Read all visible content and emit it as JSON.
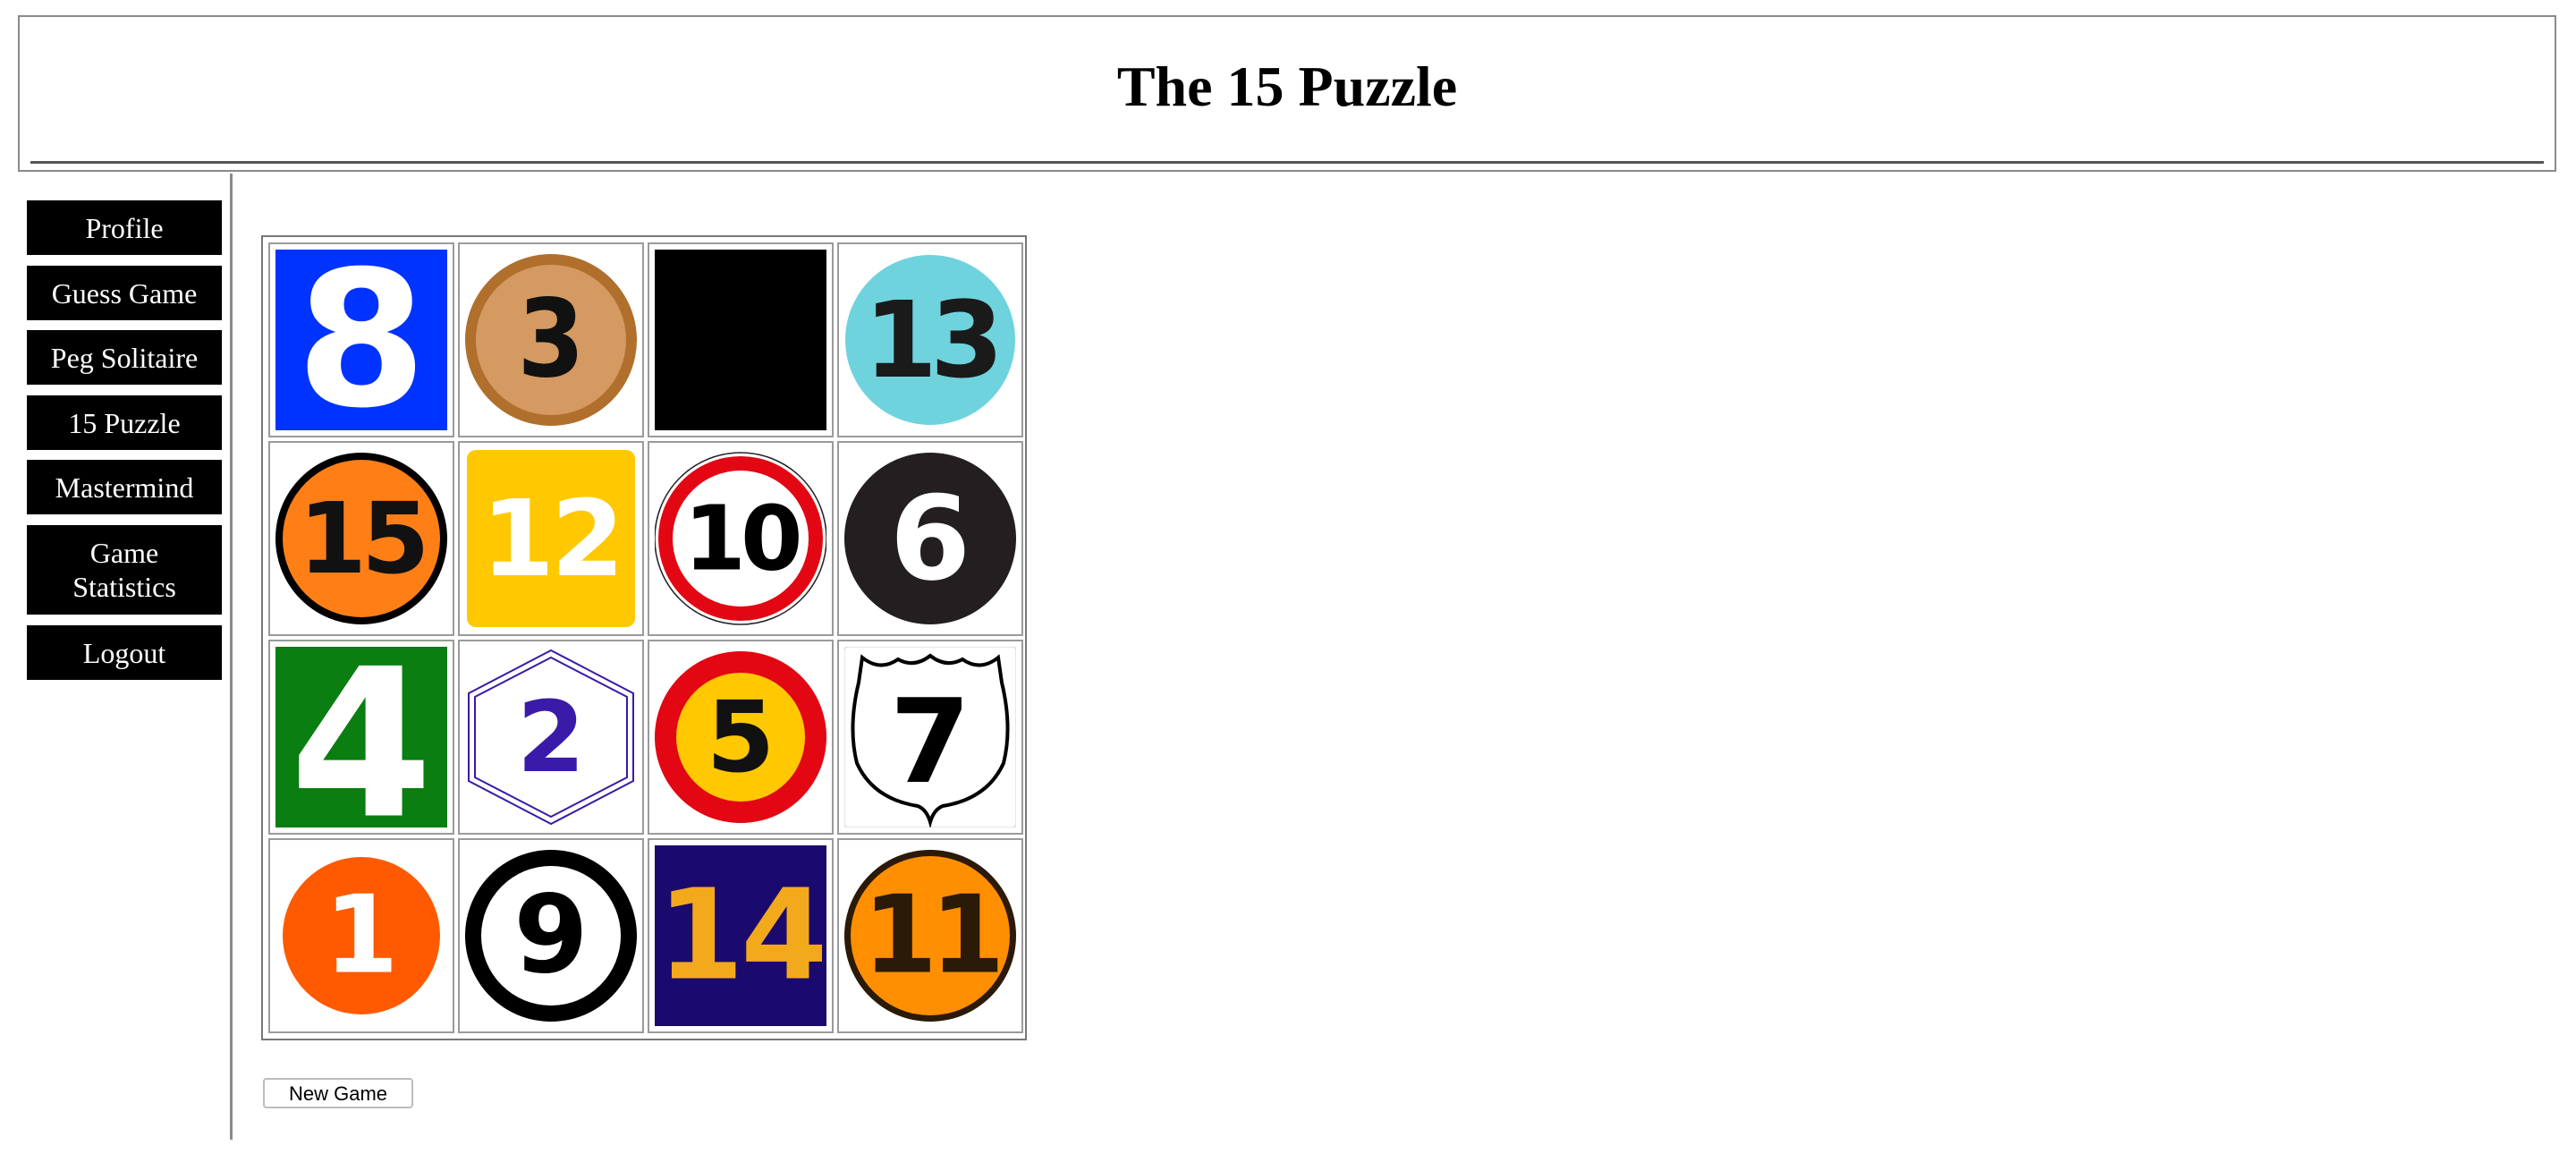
{
  "header": {
    "title": "The 15 Puzzle"
  },
  "sidebar": {
    "items": [
      {
        "label": "Profile"
      },
      {
        "label": "Guess Game"
      },
      {
        "label": "Peg Solitaire"
      },
      {
        "label": "15 Puzzle"
      },
      {
        "label": "Mastermind"
      },
      {
        "label": "Game Statistics"
      },
      {
        "label": "Logout"
      }
    ]
  },
  "puzzle": {
    "tiles": [
      {
        "value": "8",
        "style": "blue-square"
      },
      {
        "value": "3",
        "style": "bronze-circle"
      },
      {
        "value": "",
        "style": "empty-black"
      },
      {
        "value": "13",
        "style": "cyan-circle"
      },
      {
        "value": "15",
        "style": "orange-circle-black-ring"
      },
      {
        "value": "12",
        "style": "yellow-rounded-square"
      },
      {
        "value": "10",
        "style": "speed-limit-sign"
      },
      {
        "value": "6",
        "style": "black-circle"
      },
      {
        "value": "4",
        "style": "green-square"
      },
      {
        "value": "2",
        "style": "purple-hexagon"
      },
      {
        "value": "5",
        "style": "red-ring-yellow-circle"
      },
      {
        "value": "7",
        "style": "us-route-shield"
      },
      {
        "value": "1",
        "style": "orange-red-circle"
      },
      {
        "value": "9",
        "style": "black-ring-circle"
      },
      {
        "value": "14",
        "style": "navy-square"
      },
      {
        "value": "11",
        "style": "orange-circle-dark-ring"
      }
    ],
    "colors": {
      "blue": "#0033ff",
      "bronze": "#d49a62",
      "bronze_ring": "#b06f2c",
      "cyan": "#6fd3dd",
      "orange": "#ff7f17",
      "yellow": "#ffc800",
      "red": "#e30613",
      "green": "#0a7e10",
      "purple": "#3a1aa8",
      "orange_red": "#ff5a00",
      "navy": "#1a0a6e",
      "gold": "#f3a91c",
      "dark_orange": "#ff8f00"
    }
  },
  "controls": {
    "new_game_label": "New Game"
  }
}
